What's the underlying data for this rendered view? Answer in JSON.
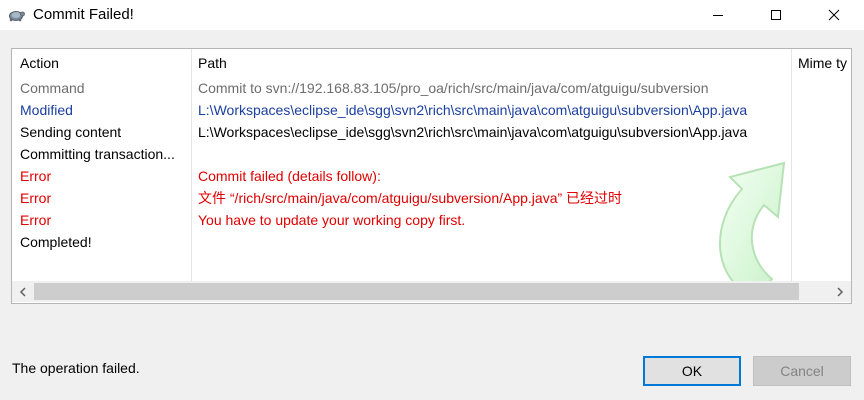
{
  "window": {
    "title": "Commit Failed!",
    "icon": "tortoise-svn-icon"
  },
  "list": {
    "headers": {
      "action": "Action",
      "path": "Path",
      "mime": "Mime ty"
    },
    "rows": [
      {
        "action": "Command",
        "path": "Commit to svn://192.168.83.105/pro_oa/rich/src/main/java/com/atguigu/subversion",
        "color": "#6d6d6d"
      },
      {
        "action": "Modified",
        "path": "L:\\Workspaces\\eclipse_ide\\sgg\\svn2\\rich\\src\\main\\java\\com\\atguigu\\subversion\\App.java",
        "color": "#1a3f9f"
      },
      {
        "action": "Sending content",
        "path": "L:\\Workspaces\\eclipse_ide\\sgg\\svn2\\rich\\src\\main\\java\\com\\atguigu\\subversion\\App.java",
        "color": "#000000"
      },
      {
        "action": "Committing transaction...",
        "path": "",
        "color": "#000000"
      },
      {
        "action": "Error",
        "path": "Commit failed (details follow):",
        "color": "#e00000"
      },
      {
        "action": "Error",
        "path": "文件 “/rich/src/main/java/com/atguigu/subversion/App.java” 已经过时",
        "color": "#e00000"
      },
      {
        "action": "Error",
        "path": "You have to update your working copy first.",
        "color": "#e00000"
      },
      {
        "action": "Completed!",
        "path": "",
        "color": "#000000"
      }
    ]
  },
  "status": "The operation failed.",
  "buttons": {
    "ok": "OK",
    "cancel": "Cancel"
  },
  "colors": {
    "error": "#e00000",
    "modified": "#1a3f9f",
    "command": "#6d6d6d",
    "ok_border": "#0078d7"
  }
}
